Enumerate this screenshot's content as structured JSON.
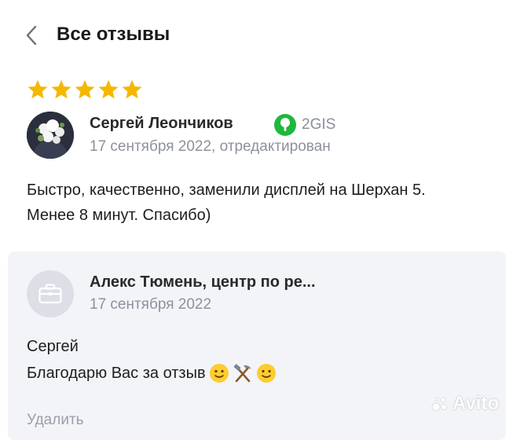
{
  "header": {
    "title": "Все отзывы",
    "back_icon": "chevron-left-icon"
  },
  "review": {
    "rating": 5,
    "max_rating": 5,
    "star_color": "#f5b800",
    "author": "Сергей Леончиков",
    "source": "2GIS",
    "source_icon": "2gis-logo-icon",
    "source_color": "#1db93c",
    "date": "17 сентября 2022, отредактирован",
    "text": "Быстро, качественно, заменили дисплей на Шерхан 5. Менее 8 минут. Спасибо)"
  },
  "reply": {
    "author": "Алекс Тюмень, центр по ре...",
    "avatar_icon": "briefcase-icon",
    "date": "17 сентября 2022",
    "greeting": "Сергей",
    "text": "Благодарю Вас за отзыв",
    "emojis": [
      "slightly-smiling-face-icon",
      "hammer-and-pick-icon",
      "slightly-smiling-face-icon"
    ],
    "delete_label": "Удалить"
  },
  "watermark": {
    "text": "Avito"
  }
}
